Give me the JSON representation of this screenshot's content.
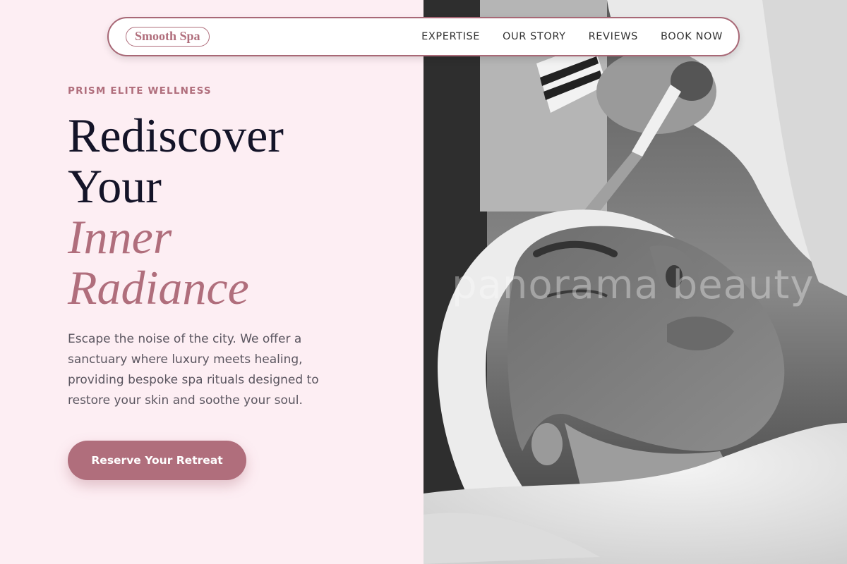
{
  "brand": {
    "name": "Smooth Spa"
  },
  "nav": {
    "items": [
      {
        "label": "EXPERTISE"
      },
      {
        "label": "OUR STORY"
      },
      {
        "label": "REVIEWS"
      },
      {
        "label": "BOOK NOW"
      }
    ]
  },
  "hero": {
    "eyebrow": "PRISM ELITE WELLNESS",
    "headline_line1": "Rediscover",
    "headline_line2": "Your",
    "headline_accent1": "Inner",
    "headline_accent2": "Radiance",
    "description": "Escape the noise of the city. We offer a sanctuary where luxury meets healing, providing bespoke spa rituals designed to restore your skin and soothe your soul.",
    "cta_label": "Reserve Your Retreat"
  },
  "image": {
    "watermark": "panorama beauty",
    "subject": "woman-receiving-facial-mask"
  },
  "colors": {
    "accent": "#b06e7c",
    "background": "#fdeef3",
    "heading": "#141428",
    "body_text": "#5b5660"
  }
}
